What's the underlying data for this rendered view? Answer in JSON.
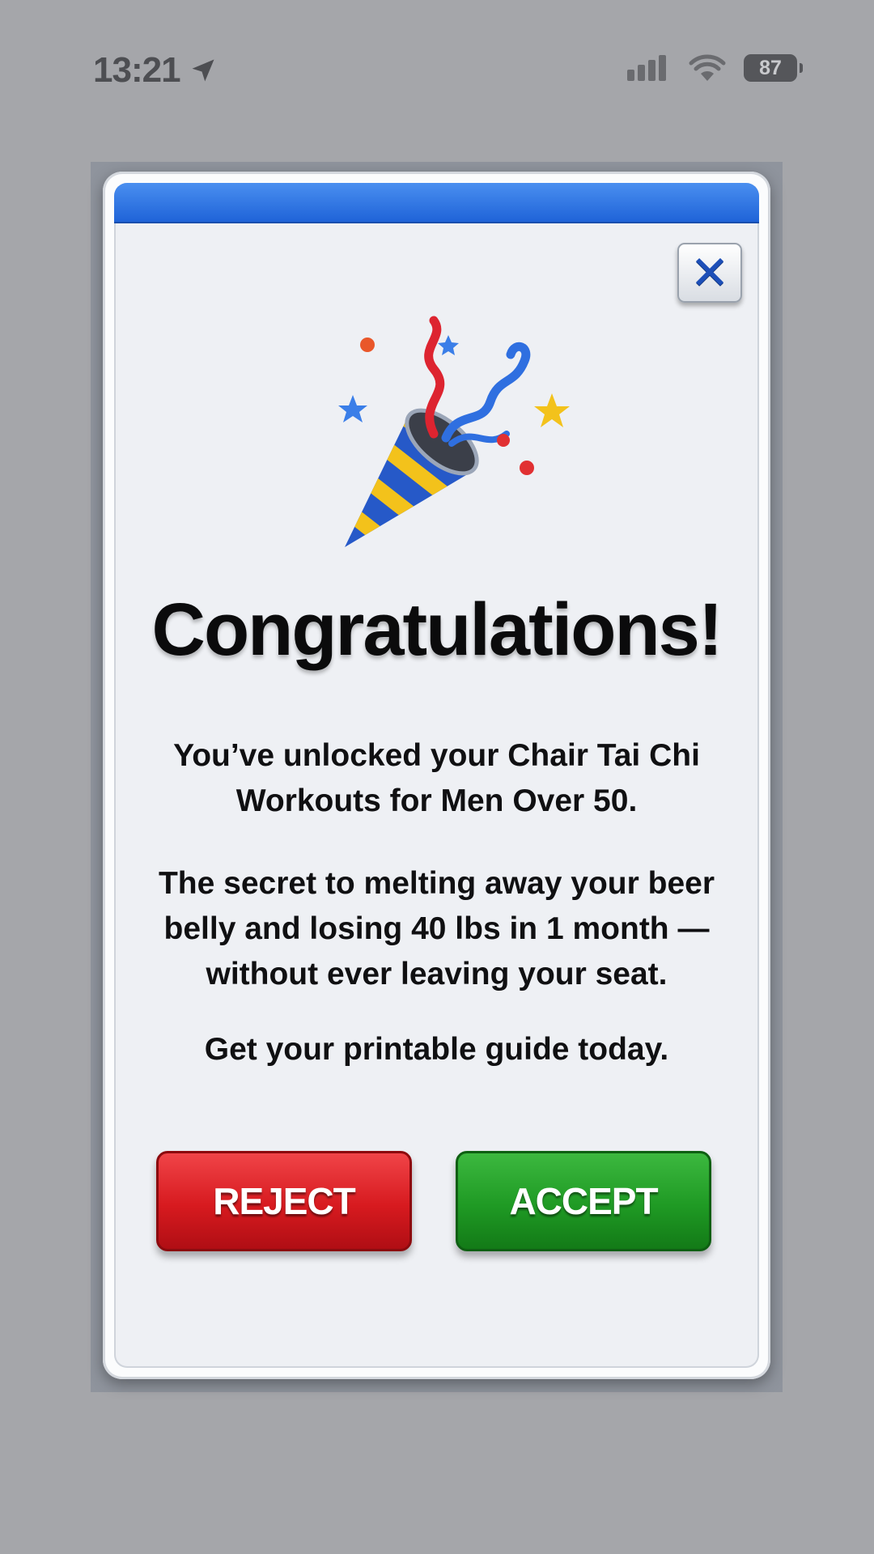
{
  "status_bar": {
    "time": "13:21",
    "battery_level": "87",
    "icons": [
      "location-arrow-icon",
      "cellular-signal-icon",
      "wifi-icon",
      "battery-icon"
    ]
  },
  "dialog": {
    "close_icon": "close-icon",
    "illustration": "party-popper-icon",
    "heading": "Congratulations!",
    "paragraph_1": "You’ve unlocked your Chair Tai Chi Workouts for Men Over 50.",
    "paragraph_2": "The secret to melting away your beer belly and losing 40 lbs in 1 month — without ever leaving your seat.",
    "paragraph_3": "Get your printable guide today.",
    "reject_label": "REJECT",
    "accept_label": "ACCEPT"
  },
  "colors": {
    "background": "#a5a6aa",
    "title_bar": "#2d74e4",
    "reject": "#d71a1f",
    "accept": "#1f9a24"
  }
}
